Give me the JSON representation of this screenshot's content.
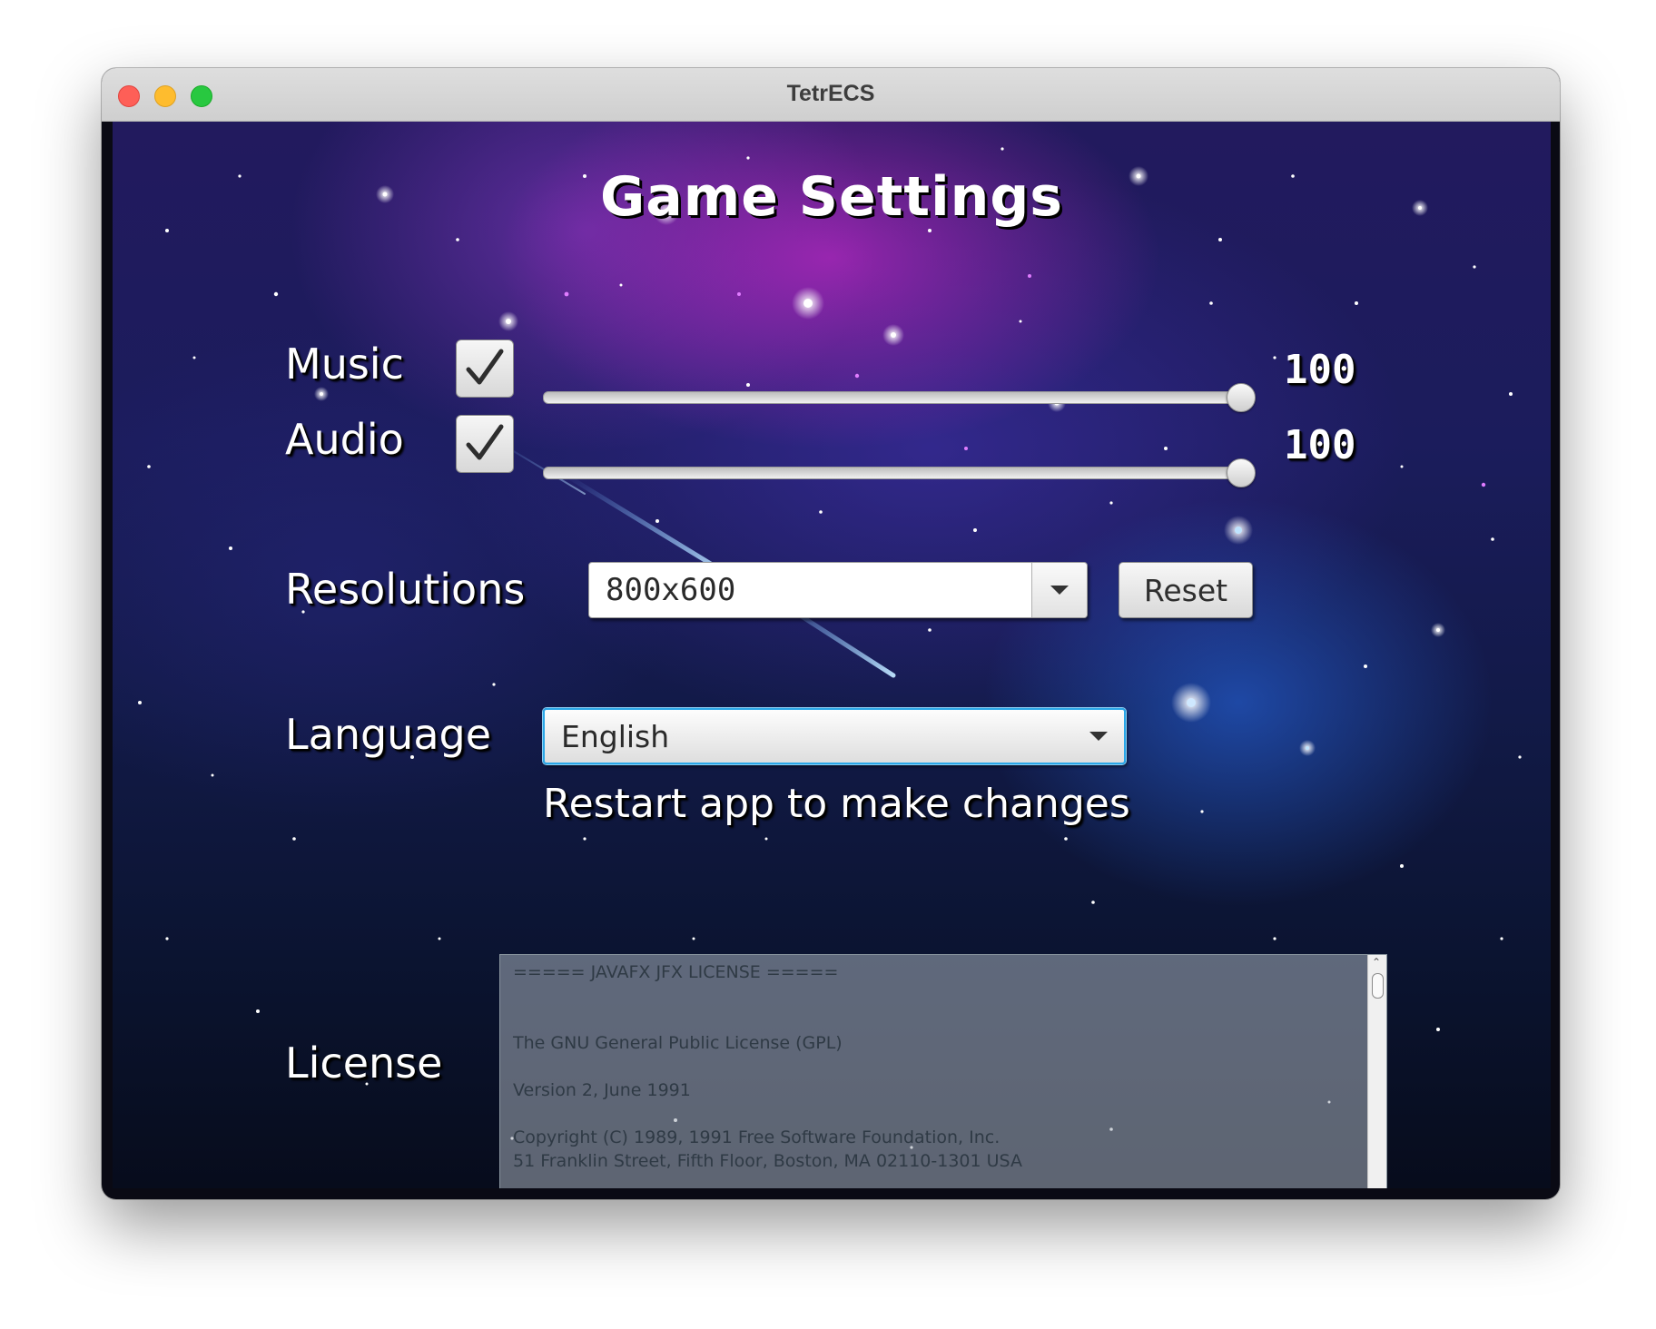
{
  "window": {
    "title": "TetrECS"
  },
  "settings": {
    "heading": "Game Settings",
    "music": {
      "label": "Music",
      "enabled": true,
      "volume": 100,
      "volume_text": "100"
    },
    "audio": {
      "label": "Audio",
      "enabled": true,
      "volume": 100,
      "volume_text": "100"
    },
    "resolutions": {
      "label": "Resolutions",
      "selected": "800x600",
      "reset_label": "Reset"
    },
    "language": {
      "label": "Language",
      "selected": "English",
      "restart_note": "Restart app to make changes"
    },
    "license": {
      "label": "License",
      "lines": [
        "===== JAVAFX JFX LICENSE =====",
        "",
        "",
        "The GNU General Public License (GPL)",
        "",
        "Version 2, June 1991",
        "",
        "Copyright (C) 1989, 1991 Free Software Foundation, Inc.",
        "51 Franklin Street, Fifth Floor, Boston, MA 02110-1301 USA"
      ]
    }
  },
  "colors": {
    "close": "#fe5f57",
    "minimize": "#febc2e",
    "maximize": "#28c840",
    "focus_ring": "#2aa7e8"
  },
  "icons": {
    "checkmark": "checkmark-icon",
    "dropdown": "chevron-down-icon",
    "scroll_up": "chevron-up-icon",
    "scroll_down": "chevron-down-icon"
  }
}
